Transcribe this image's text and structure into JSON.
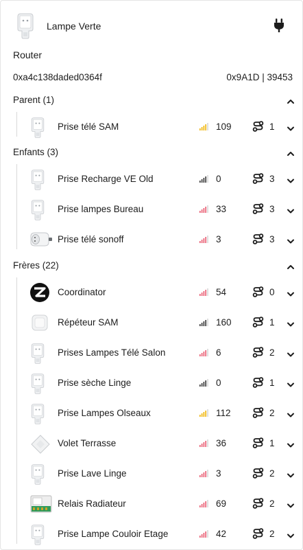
{
  "device": {
    "name": "Lampe Verte",
    "icon": "smart-plug",
    "power_icon": "plug-icon",
    "role": "Router",
    "ieee": "0xa4c138daded0364f",
    "nwk": "0x9A1D | 39453"
  },
  "colors": {
    "signal_good": "#333333",
    "signal_medium": "#f0b400",
    "signal_low": "#e8586e",
    "signal_empty": "#d6d6d6",
    "line": "#d9d9d9"
  },
  "sections": [
    {
      "title": "Parent (1)",
      "expanded": true,
      "items": [
        {
          "name": "Prise télé SAM",
          "icon": "smart-plug",
          "lqi": "109",
          "signal_level": 4,
          "signal_color": "medium",
          "routes": "1"
        }
      ]
    },
    {
      "title": "Enfants (3)",
      "expanded": true,
      "items": [
        {
          "name": "Prise Recharge VE Old",
          "icon": "smart-plug",
          "lqi": "0",
          "signal_level": 4,
          "signal_color": "good",
          "routes": "3"
        },
        {
          "name": "Prise lampes Bureau",
          "icon": "smart-plug",
          "lqi": "33",
          "signal_level": 4,
          "signal_color": "low",
          "routes": "3"
        },
        {
          "name": "Prise télé sonoff",
          "icon": "sonoff-plug",
          "lqi": "3",
          "signal_level": 4,
          "signal_color": "low",
          "routes": "3"
        }
      ]
    },
    {
      "title": "Frères (22)",
      "expanded": true,
      "items": [
        {
          "name": "Coordinator",
          "icon": "zigbee-logo",
          "lqi": "54",
          "signal_level": 4,
          "signal_color": "low",
          "routes": "0"
        },
        {
          "name": "Répéteur SAM",
          "icon": "repeater",
          "lqi": "160",
          "signal_level": 4,
          "signal_color": "good",
          "routes": "1"
        },
        {
          "name": "Prises Lampes Télé Salon",
          "icon": "smart-plug",
          "lqi": "6",
          "signal_level": 4,
          "signal_color": "low",
          "routes": "2"
        },
        {
          "name": "Prise sèche Linge",
          "icon": "smart-plug",
          "lqi": "0",
          "signal_level": 4,
          "signal_color": "good",
          "routes": "1"
        },
        {
          "name": "Prise Lampes Olseaux",
          "icon": "smart-plug",
          "lqi": "112",
          "signal_level": 4,
          "signal_color": "medium",
          "routes": "2"
        },
        {
          "name": "Volet Terrasse",
          "icon": "wall-switch",
          "lqi": "36",
          "signal_level": 4,
          "signal_color": "low",
          "routes": "1"
        },
        {
          "name": "Prise Lave Linge",
          "icon": "smart-plug",
          "lqi": "3",
          "signal_level": 4,
          "signal_color": "low",
          "routes": "2"
        },
        {
          "name": "Relais Radiateur",
          "icon": "relay-module",
          "lqi": "69",
          "signal_level": 4,
          "signal_color": "low",
          "routes": "2"
        },
        {
          "name": "Prise Lampe Couloir Etage",
          "icon": "smart-plug",
          "lqi": "42",
          "signal_level": 4,
          "signal_color": "low",
          "routes": "2"
        }
      ]
    }
  ]
}
